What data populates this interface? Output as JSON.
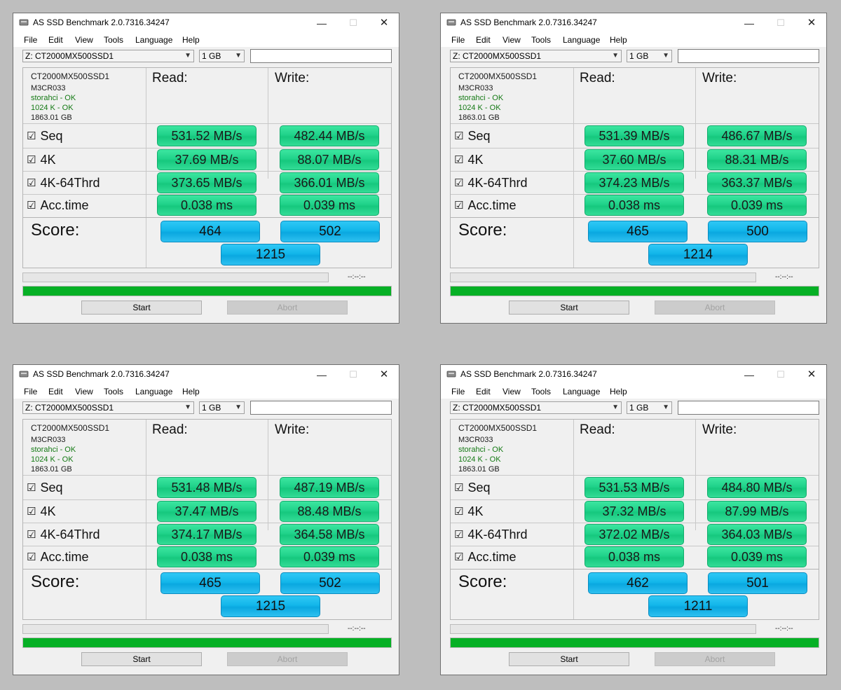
{
  "title": "AS SSD Benchmark 2.0.7316.34247",
  "menu": [
    "File",
    "Edit",
    "View",
    "Tools",
    "Language",
    "Help"
  ],
  "drive_select": "Z: CT2000MX500SSD1",
  "size_select": "1 GB",
  "info": {
    "model": "CT2000MX500SSD1",
    "firmware": "M3CR033",
    "driver": "storahci - OK",
    "alignment": "1024 K - OK",
    "capacity": "1863.01 GB"
  },
  "headers": {
    "read": "Read:",
    "write": "Write:"
  },
  "labels": {
    "seq": "Seq",
    "k4": "4K",
    "k4_64": "4K-64Thrd",
    "acc": "Acc.time",
    "score": "Score:"
  },
  "checkbox_glyph": "☑",
  "time_text": "--:--:--",
  "buttons": {
    "start": "Start",
    "abort": "Abort"
  },
  "window_controls": {
    "min": "—",
    "max": "☐",
    "close": "✕"
  },
  "windows": [
    {
      "seq_read": "531.52 MB/s",
      "seq_write": "482.44 MB/s",
      "k4_read": "37.69 MB/s",
      "k4_write": "88.07 MB/s",
      "k4_64_read": "373.65 MB/s",
      "k4_64_write": "366.01 MB/s",
      "acc_read": "0.038 ms",
      "acc_write": "0.039 ms",
      "score_read": "464",
      "score_write": "502",
      "score_total": "1215",
      "progress_bottom": 1.0,
      "progress_top": 0.0
    },
    {
      "seq_read": "531.39 MB/s",
      "seq_write": "486.67 MB/s",
      "k4_read": "37.60 MB/s",
      "k4_write": "88.31 MB/s",
      "k4_64_read": "374.23 MB/s",
      "k4_64_write": "363.37 MB/s",
      "acc_read": "0.038 ms",
      "acc_write": "0.039 ms",
      "score_read": "465",
      "score_write": "500",
      "score_total": "1214",
      "progress_bottom": 1.0,
      "progress_top": 0.0
    },
    {
      "seq_read": "531.48 MB/s",
      "seq_write": "487.19 MB/s",
      "k4_read": "37.47 MB/s",
      "k4_write": "88.48 MB/s",
      "k4_64_read": "374.17 MB/s",
      "k4_64_write": "364.58 MB/s",
      "acc_read": "0.038 ms",
      "acc_write": "0.039 ms",
      "score_read": "465",
      "score_write": "502",
      "score_total": "1215",
      "progress_bottom": 1.0,
      "progress_top": 0.0
    },
    {
      "seq_read": "531.53 MB/s",
      "seq_write": "484.80 MB/s",
      "k4_read": "37.32 MB/s",
      "k4_write": "87.99 MB/s",
      "k4_64_read": "372.02 MB/s",
      "k4_64_write": "364.03 MB/s",
      "acc_read": "0.038 ms",
      "acc_write": "0.039 ms",
      "score_read": "462",
      "score_write": "501",
      "score_total": "1211",
      "progress_bottom": 1.0,
      "progress_top": 0.0
    }
  ],
  "colors": {
    "result_green": "#20d28a",
    "score_blue": "#12b6ea",
    "progress_green": "#06b025",
    "info_green": "#157a15"
  }
}
